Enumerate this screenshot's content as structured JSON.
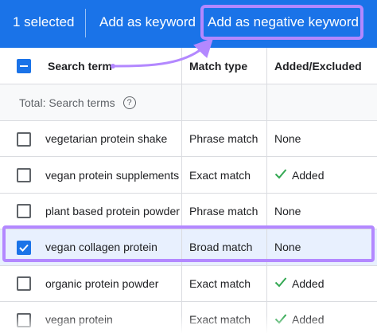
{
  "toolbar": {
    "selected_label": "1 selected",
    "add_keyword_label": "Add as keyword",
    "add_negative_label": "Add as negative keyword"
  },
  "columns": {
    "search_term": "Search term",
    "match_type": "Match type",
    "added_excluded": "Added/Excluded"
  },
  "total_label": "Total: Search terms",
  "rows": [
    {
      "term": "vegetarian protein shake",
      "match": "Phrase match",
      "status": "None",
      "checked": false
    },
    {
      "term": "vegan protein supplements",
      "match": "Exact match",
      "status": "Added",
      "checked": false
    },
    {
      "term": "plant based protein powder",
      "match": "Phrase match",
      "status": "None",
      "checked": false
    },
    {
      "term": "vegan collagen protein",
      "match": "Broad match",
      "status": "None",
      "checked": true
    },
    {
      "term": "organic protein powder",
      "match": "Exact match",
      "status": "Added",
      "checked": false
    },
    {
      "term": "vegan protein",
      "match": "Exact match",
      "status": "Added",
      "checked": false
    }
  ],
  "colors": {
    "primary": "#1a73e8",
    "highlight": "#b388ff",
    "added_check": "#34a853",
    "selected_row": "#e8f0fe"
  }
}
